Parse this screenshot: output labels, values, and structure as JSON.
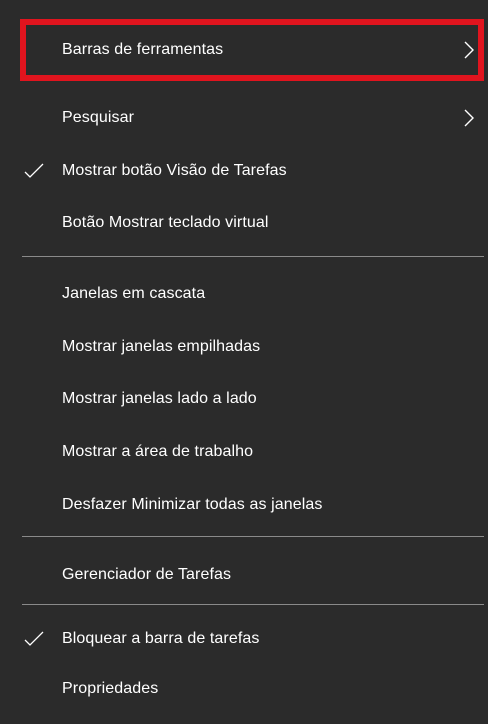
{
  "context_menu": {
    "items": [
      {
        "label": "Barras de ferramentas",
        "checked": false,
        "submenu": true,
        "highlighted": true
      },
      {
        "label": "Pesquisar",
        "checked": false,
        "submenu": true
      },
      {
        "label": "Mostrar botão Visão de Tarefas",
        "checked": true,
        "submenu": false
      },
      {
        "label": "Botão Mostrar teclado virtual",
        "checked": false,
        "submenu": false
      },
      {
        "label": "Janelas em cascata",
        "checked": false,
        "submenu": false
      },
      {
        "label": "Mostrar janelas empilhadas",
        "checked": false,
        "submenu": false
      },
      {
        "label": "Mostrar janelas lado a lado",
        "checked": false,
        "submenu": false
      },
      {
        "label": "Mostrar a área de trabalho",
        "checked": false,
        "submenu": false
      },
      {
        "label": "Desfazer Minimizar todas as janelas",
        "checked": false,
        "submenu": false
      },
      {
        "label": "Gerenciador de Tarefas",
        "checked": false,
        "submenu": false
      },
      {
        "label": "Bloquear a barra de tarefas",
        "checked": true,
        "submenu": false
      },
      {
        "label": "Propriedades",
        "checked": false,
        "submenu": false
      }
    ]
  },
  "colors": {
    "menu_background": "#2b2b2b",
    "text": "#ffffff",
    "highlight_border": "#e0141e",
    "separator": "#8a8a8a"
  },
  "icons": {
    "check": "checkmark-icon",
    "submenu": "chevron-right-icon"
  }
}
